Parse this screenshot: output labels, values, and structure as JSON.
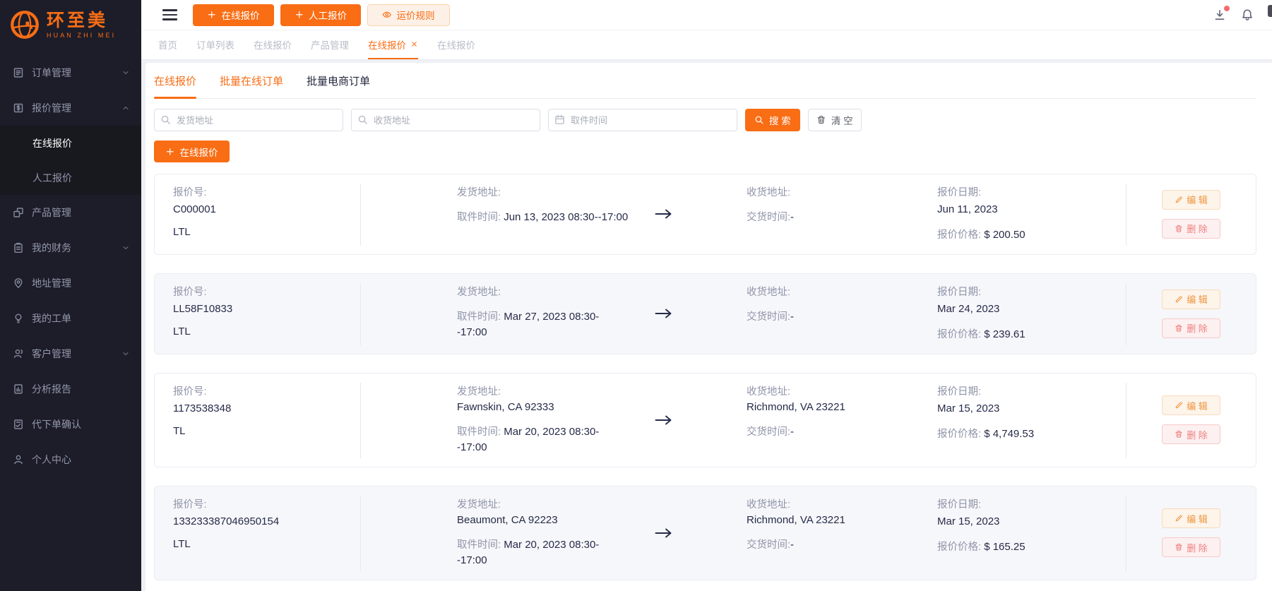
{
  "colors": {
    "primary": "#f96d15",
    "danger": "#f56c6c"
  },
  "brand": {
    "name": "环至美",
    "tagline": "HUAN ZHI MEI"
  },
  "sidebar": [
    {
      "label": "订单管理",
      "icon": "order-icon",
      "chevron": "down"
    },
    {
      "label": "报价管理",
      "icon": "quote-icon",
      "chevron": "up",
      "children": [
        {
          "label": "在线报价",
          "active": true
        },
        {
          "label": "人工报价",
          "active": false
        }
      ]
    },
    {
      "label": "产品管理",
      "icon": "product-icon"
    },
    {
      "label": "我的财务",
      "icon": "finance-icon",
      "chevron": "down"
    },
    {
      "label": "地址管理",
      "icon": "address-icon"
    },
    {
      "label": "我的工单",
      "icon": "ticket-icon"
    },
    {
      "label": "客户管理",
      "icon": "customer-icon",
      "chevron": "down"
    },
    {
      "label": "分析报告",
      "icon": "report-icon"
    },
    {
      "label": "代下单确认",
      "icon": "confirm-icon"
    },
    {
      "label": "个人中心",
      "icon": "profile-icon"
    }
  ],
  "header": {
    "actions": [
      {
        "label": "在线报价",
        "icon": "plus-icon",
        "style": "primary"
      },
      {
        "label": "人工报价",
        "icon": "plus-icon",
        "style": "primary"
      },
      {
        "label": "运价规则",
        "icon": "eye-icon",
        "style": "soft"
      }
    ],
    "right_icons": [
      {
        "name": "download-icon",
        "badge": true
      },
      {
        "name": "bell-icon",
        "badge": false
      }
    ]
  },
  "tabs": [
    {
      "label": "首页",
      "active": false,
      "closable": false
    },
    {
      "label": "订单列表",
      "active": false,
      "closable": false
    },
    {
      "label": "在线报价",
      "active": false,
      "closable": false
    },
    {
      "label": "产品管理",
      "active": false,
      "closable": false
    },
    {
      "label": "在线报价",
      "active": true,
      "closable": true
    },
    {
      "label": "在线报价",
      "active": false,
      "closable": false
    }
  ],
  "subtabs": [
    {
      "label": "在线报价",
      "state": "active"
    },
    {
      "label": "批量在线订单",
      "state": "accent"
    },
    {
      "label": "批量电商订单",
      "state": "default"
    }
  ],
  "filters": {
    "from_placeholder": "发货地址",
    "to_placeholder": "收货地址",
    "time_placeholder": "取件时间",
    "search_label": "搜 索",
    "clear_label": "清 空"
  },
  "create_label": "在线报价",
  "card_labels": {
    "quote_no": "报价号:",
    "from": "发货地址:",
    "pickup": "取件时间:",
    "to": "收货地址:",
    "delivery": "交货时间:",
    "quote_date": "报价日期:",
    "price": "报价价格:"
  },
  "row_actions": {
    "edit": "编 辑",
    "delete": "删 除"
  },
  "quotes": [
    {
      "no": "C000001",
      "type": "LTL",
      "from": "",
      "pickup_l1": "Jun 13, 2023 08:30--17:00",
      "pickup_l2": "",
      "to": "",
      "delivery": "-",
      "date": "Jun 11, 2023",
      "price": "$ 200.50"
    },
    {
      "no": "LL58F10833",
      "type": "LTL",
      "from": "",
      "pickup_l1": "Mar 27, 2023 08:30-",
      "pickup_l2": "-17:00",
      "to": "",
      "delivery": "-",
      "date": "Mar 24, 2023",
      "price": "$ 239.61"
    },
    {
      "no": "1173538348",
      "type": "TL",
      "from": "Fawnskin, CA 92333",
      "pickup_l1": "Mar 20, 2023 08:30-",
      "pickup_l2": "-17:00",
      "to": "Richmond, VA 23221",
      "delivery": "-",
      "date": "Mar 15, 2023",
      "price": "$ 4,749.53"
    },
    {
      "no": "133233387046950154",
      "type": "LTL",
      "from": "Beaumont, CA 92223",
      "pickup_l1": "Mar 20, 2023 08:30-",
      "pickup_l2": "-17:00",
      "to": "Richmond, VA 23221",
      "delivery": "-",
      "date": "Mar 15, 2023",
      "price": "$ 165.25"
    }
  ]
}
